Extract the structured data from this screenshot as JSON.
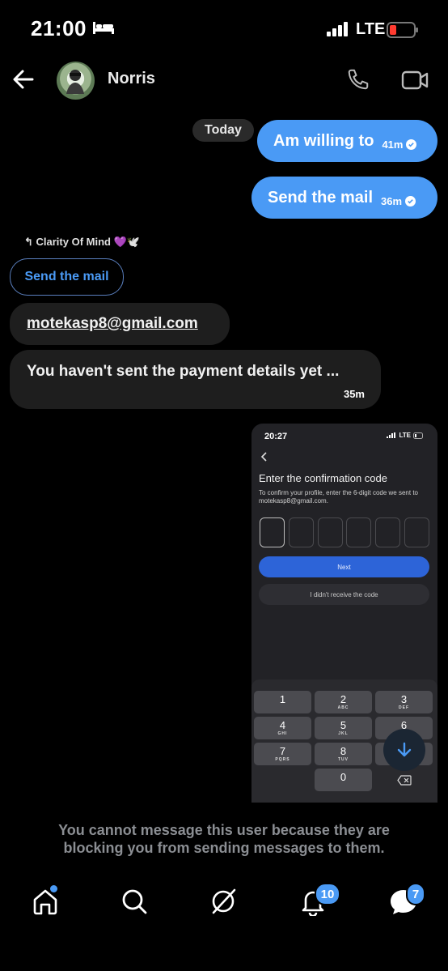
{
  "status_bar": {
    "time": "21:00",
    "network": "LTE"
  },
  "header": {
    "contact_name": "Norris"
  },
  "messages": {
    "date_chip": "Today",
    "sent": [
      {
        "text": "Am willing to",
        "time": "41m"
      },
      {
        "text": "Send the mail",
        "time": "36m"
      }
    ],
    "reply_header": "Clarity Of Mind 💜🕊️",
    "quoted_text": "Send the mail",
    "received": [
      {
        "text": "motekasp8@gmail.com"
      },
      {
        "text": "You haven't sent the payment details yet ...",
        "time": "35m"
      }
    ]
  },
  "shared_screenshot": {
    "time": "20:27",
    "network": "LTE",
    "heading": "Enter the confirmation code",
    "description": "To confirm your profile, enter the 6-digit code we sent to motekasp8@gmail.com.",
    "next_label": "Next",
    "no_code_label": "I didn't receive the code",
    "keypad": [
      {
        "n": "1",
        "l": ""
      },
      {
        "n": "2",
        "l": "ABC"
      },
      {
        "n": "3",
        "l": "DEF"
      },
      {
        "n": "4",
        "l": "GHI"
      },
      {
        "n": "5",
        "l": "JKL"
      },
      {
        "n": "6",
        "l": "MNO"
      },
      {
        "n": "7",
        "l": "PQRS"
      },
      {
        "n": "8",
        "l": "TUV"
      },
      {
        "n": "9",
        "l": "WXYZ"
      },
      {
        "n": "0",
        "l": ""
      }
    ]
  },
  "blocked_notice": "You cannot message this user because they are blocking you from sending messages to them.",
  "bottom_nav": {
    "notifications_badge": "10",
    "messages_badge": "7"
  },
  "colors": {
    "accent": "#4a9af5",
    "background": "#000000",
    "bubble_in": "#1e1e1e"
  }
}
